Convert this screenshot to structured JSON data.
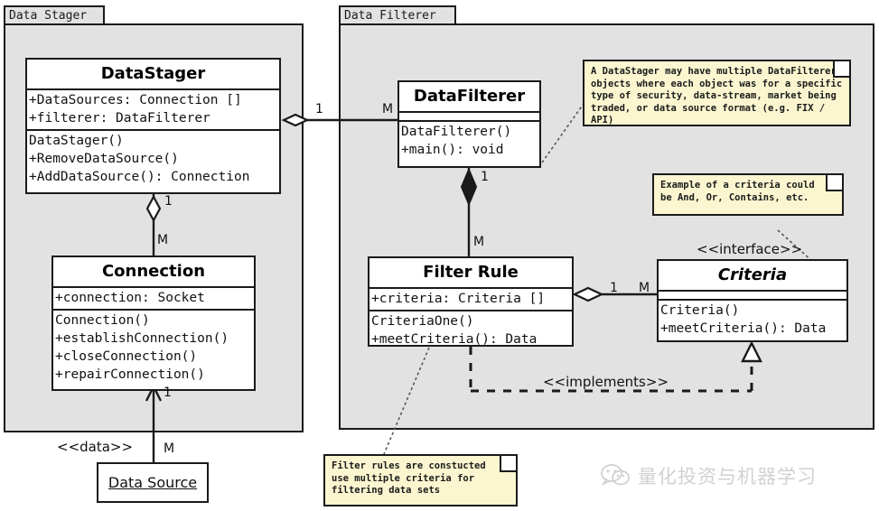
{
  "diagram": {
    "title": "UML Class Diagram - Data Stager / Data Filterer",
    "colors": {
      "package_fill": "#e2e2e2",
      "class_fill": "#ffffff",
      "note_fill": "#fbf6d0",
      "stroke": "#1a1a1a",
      "canvas": "#ffffff"
    }
  },
  "packages": [
    {
      "name": "Data Stager"
    },
    {
      "name": "Data Filterer"
    }
  ],
  "classes": {
    "data_stager": {
      "name": "DataStager",
      "attributes": [
        "+DataSources: Connection []",
        "+filterer: DataFilterer"
      ],
      "methods": [
        " DataStager()",
        "+RemoveDataSource()",
        "+AddDataSource(): Connection"
      ]
    },
    "connection": {
      "name": "Connection",
      "attributes": [
        "+connection: Socket"
      ],
      "methods": [
        " Connection()",
        "+establishConnection()",
        "+closeConnection()",
        "+repairConnection()"
      ]
    },
    "data_filterer": {
      "name": "DataFilterer",
      "attributes": [],
      "methods": [
        " DataFilterer()",
        "+main(): void"
      ]
    },
    "filter_rule": {
      "name": "Filter Rule",
      "attributes": [
        "+criteria: Criteria []"
      ],
      "methods": [
        " CriteriaOne()",
        "+meetCriteria(): Data"
      ]
    },
    "criteria": {
      "stereotype": "<<interface>>",
      "name": "Criteria",
      "attributes": [],
      "methods": [
        " Criteria()",
        "+meetCriteria(): Data"
      ]
    }
  },
  "objects": {
    "data_source": {
      "name": "Data Source"
    }
  },
  "notes": [
    {
      "id": "note-datastager-filterer",
      "text": "A DataStager may have multiple DataFilterer\nobjects where each object was for a specific\ntype of security, data-stream, market being\ntraded, or data source format (e.g. FIX / API)"
    },
    {
      "id": "note-criteria-example",
      "text": "Example of a criteria could\nbe And, Or, Contains, etc."
    },
    {
      "id": "note-filter-rules",
      "text": "Filter rules are constucted\nuse multiple criteria for\nfiltering data sets"
    }
  ],
  "relationships": [
    {
      "id": "rel-stager-filterer",
      "type": "aggregation",
      "from": "DataStager",
      "to": "DataFilterer",
      "from_multiplicity": "1",
      "to_multiplicity": "M"
    },
    {
      "id": "rel-stager-connection",
      "type": "aggregation",
      "from": "DataStager",
      "to": "Connection",
      "from_multiplicity": "1",
      "to_multiplicity": "M"
    },
    {
      "id": "rel-connection-datasource",
      "type": "directed-association",
      "from": "Connection",
      "to": "Data Source",
      "from_multiplicity": "1",
      "to_multiplicity": "M",
      "label": "<<data>>"
    },
    {
      "id": "rel-filterer-filterrule",
      "type": "composition",
      "from": "DataFilterer",
      "to": "Filter Rule",
      "from_multiplicity": "1",
      "to_multiplicity": "M"
    },
    {
      "id": "rel-filterrule-criteria",
      "type": "aggregation",
      "from": "Filter Rule",
      "to": "Criteria",
      "from_multiplicity": "1",
      "to_multiplicity": "M"
    },
    {
      "id": "rel-filterrule-implements-criteria",
      "type": "realization",
      "from": "Filter Rule",
      "to": "Criteria",
      "label": "<<implements>>"
    }
  ],
  "labels": {
    "mult_stager_filterer_1": "1",
    "mult_stager_filterer_m": "M",
    "mult_stager_connection_1": "1",
    "mult_stager_connection_m": "M",
    "mult_connection_datasource_1": "1",
    "mult_connection_datasource_m": "M",
    "mult_filterer_rule_1": "1",
    "mult_filterer_rule_m": "M",
    "mult_rule_criteria_1": "1",
    "mult_rule_criteria_m": "M",
    "stereo_data": "<<data>>",
    "stereo_implements": "<<implements>>",
    "stereo_interface": "<<interface>>"
  },
  "watermark": {
    "text": "量化投资与机器学习",
    "icon": "wechat-icon"
  }
}
